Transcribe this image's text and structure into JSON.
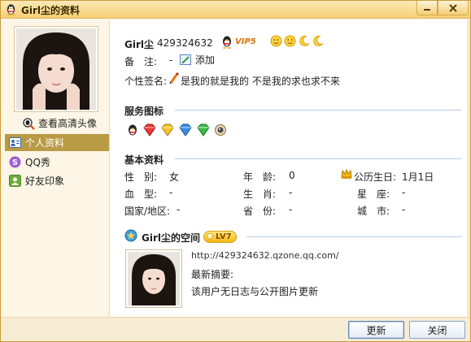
{
  "window": {
    "title": "Girl尘的资料"
  },
  "left": {
    "view_hd_avatar": "查看高清头像",
    "nav": [
      {
        "label": "个人资料"
      },
      {
        "label": "QQ秀"
      },
      {
        "label": "好友印象"
      }
    ]
  },
  "profile": {
    "nickname": "Girl尘",
    "qq_number": "429324632",
    "vip_label": "VIP5",
    "remark_label": "备　注:",
    "remark_value": "-",
    "remark_add": "添加",
    "signature_label": "个性签名:",
    "signature": "是我的就是我的 不是我的求也求不来"
  },
  "service_icons": {
    "title": "服务图标"
  },
  "basic_info": {
    "title": "基本资料",
    "rows": [
      [
        {
          "label": "性　别:",
          "value": "女"
        },
        {
          "label": "年　龄:",
          "value": "0"
        },
        {
          "label": "公历生日:",
          "value": "1月1日"
        }
      ],
      [
        {
          "label": "血　型:",
          "value": "-"
        },
        {
          "label": "生　肖:",
          "value": "-"
        },
        {
          "label": "星　座:",
          "value": "-"
        }
      ],
      [
        {
          "label": "国家/地区:",
          "value": "-"
        },
        {
          "label": "省　份:",
          "value": "-"
        },
        {
          "label": "城　市:",
          "value": "-"
        }
      ]
    ]
  },
  "qzone": {
    "title": "Girl尘的空间",
    "level": "LV7",
    "url": "http://429324632.qzone.qq.com/",
    "latest_label": "最新摘要:",
    "latest_text": "该用户无日志与公开图片更新"
  },
  "buttons": {
    "refresh": "更新",
    "close": "关闭"
  },
  "colors": {
    "titlebar": "#f6cf74",
    "nav_active": "#b99a45",
    "section_line": "#b9cde6",
    "button_border": "#8aa3c4"
  }
}
